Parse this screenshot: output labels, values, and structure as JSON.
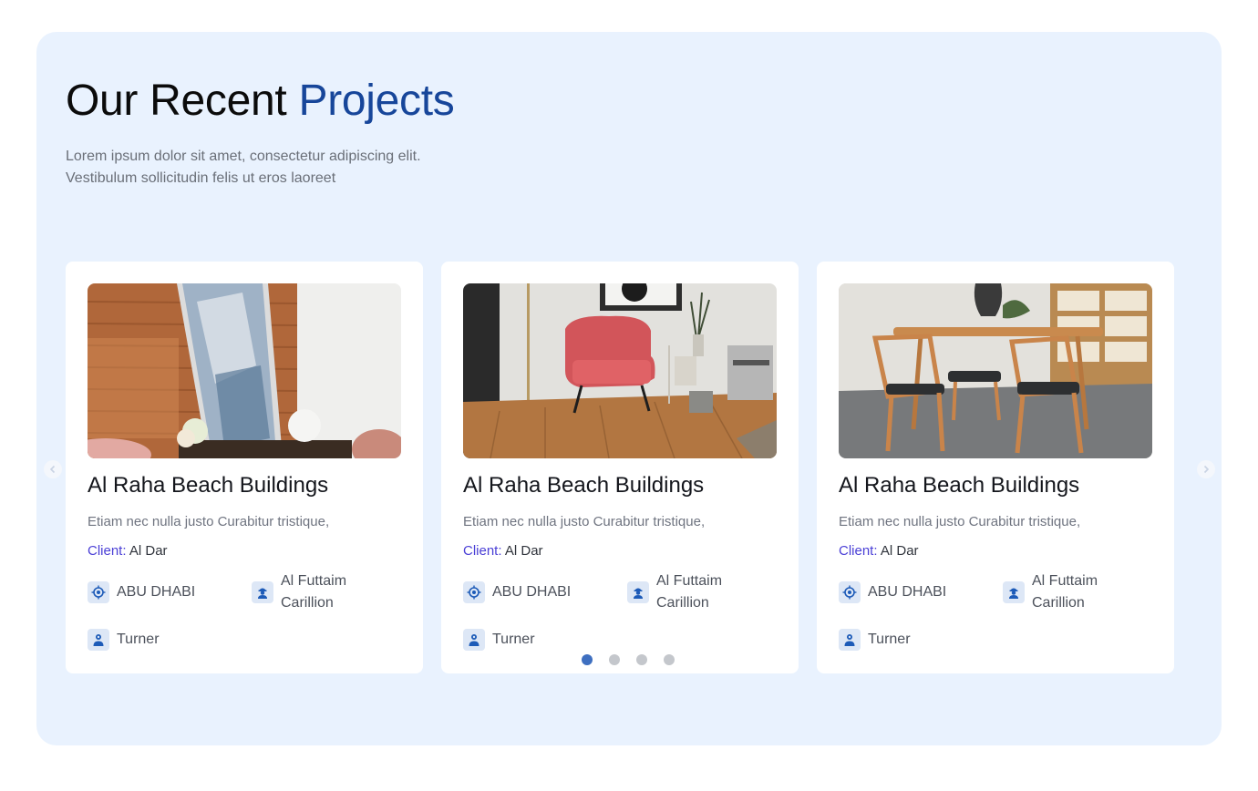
{
  "section": {
    "heading_main": "Our Recent ",
    "heading_accent": "Projects",
    "lead_line1": "Lorem ipsum dolor sit amet, consectetur adipiscing elit.",
    "lead_line2": "Vestibulum sollicitudin felis ut eros laoreet"
  },
  "projects": [
    {
      "title": "Al Raha Beach Buildings",
      "description": "Etiam nec nulla justo Curabitur tristique,",
      "client_label": "Client:",
      "client_value": " Al Dar",
      "location": "ABU DHABI",
      "contractor_line1": "Al Futtaim",
      "contractor_line2": "Carillion",
      "consultant": "Turner",
      "image": "living-room-wall-art-photo"
    },
    {
      "title": "Al Raha Beach Buildings",
      "description": "Etiam nec nulla justo Curabitur tristique,",
      "client_label": "Client:",
      "client_value": " Al Dar",
      "location": "ABU DHABI",
      "contractor_line1": "Al Futtaim",
      "contractor_line2": "Carillion",
      "consultant": "Turner",
      "image": "red-armchair-photo"
    },
    {
      "title": "Al Raha Beach Buildings",
      "description": "Etiam nec nulla justo Curabitur tristique,",
      "client_label": "Client:",
      "client_value": " Al Dar",
      "location": "ABU DHABI",
      "contractor_line1": "Al Futtaim",
      "contractor_line2": "Carillion",
      "consultant": "Turner",
      "image": "dining-table-chairs-photo"
    }
  ],
  "carousel": {
    "active_index": 0,
    "dot_count": 4
  },
  "colors": {
    "accent": "#17469a",
    "client_label": "#4a3fd6",
    "section_bg": "#e9f2fe",
    "dot_active": "#3e6fc0"
  }
}
